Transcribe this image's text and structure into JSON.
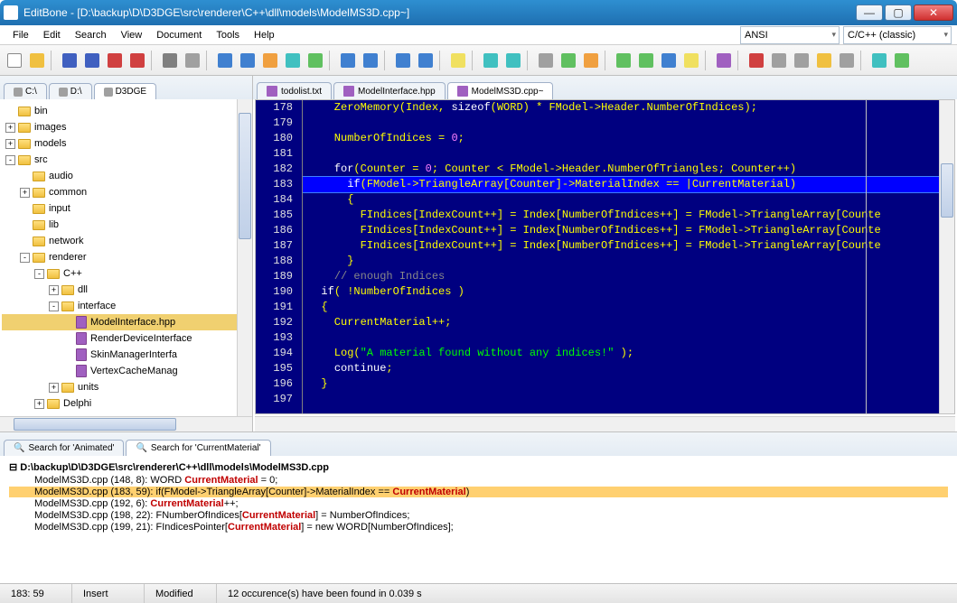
{
  "title": "EditBone - [D:\\backup\\D\\D3DGE\\src\\renderer\\C++\\dll\\models\\ModelMS3D.cpp~]",
  "menu": [
    "File",
    "Edit",
    "Search",
    "View",
    "Document",
    "Tools",
    "Help"
  ],
  "encoding": "ANSI",
  "language": "C/C++ (classic)",
  "drive_tabs": [
    {
      "label": "C:\\",
      "active": false
    },
    {
      "label": "D:\\",
      "active": false
    },
    {
      "label": "D3DGE",
      "active": true
    }
  ],
  "tree": [
    {
      "indent": 0,
      "exp": "",
      "icon": "folder",
      "label": "bin"
    },
    {
      "indent": 0,
      "exp": "+",
      "icon": "folder",
      "label": "images"
    },
    {
      "indent": 0,
      "exp": "+",
      "icon": "folder",
      "label": "models"
    },
    {
      "indent": 0,
      "exp": "-",
      "icon": "folder",
      "label": "src"
    },
    {
      "indent": 1,
      "exp": "",
      "icon": "folder",
      "label": "audio"
    },
    {
      "indent": 1,
      "exp": "+",
      "icon": "folder",
      "label": "common"
    },
    {
      "indent": 1,
      "exp": "",
      "icon": "folder",
      "label": "input"
    },
    {
      "indent": 1,
      "exp": "",
      "icon": "folder",
      "label": "lib"
    },
    {
      "indent": 1,
      "exp": "",
      "icon": "folder",
      "label": "network"
    },
    {
      "indent": 1,
      "exp": "-",
      "icon": "folder",
      "label": "renderer"
    },
    {
      "indent": 2,
      "exp": "-",
      "icon": "folder",
      "label": "C++"
    },
    {
      "indent": 3,
      "exp": "+",
      "icon": "folder",
      "label": "dll"
    },
    {
      "indent": 3,
      "exp": "-",
      "icon": "folder",
      "label": "interface"
    },
    {
      "indent": 4,
      "exp": "",
      "icon": "file",
      "label": "ModelInterface.hpp",
      "selected": true
    },
    {
      "indent": 4,
      "exp": "",
      "icon": "file",
      "label": "RenderDeviceInterface"
    },
    {
      "indent": 4,
      "exp": "",
      "icon": "file",
      "label": "SkinManagerInterfa"
    },
    {
      "indent": 4,
      "exp": "",
      "icon": "file",
      "label": "VertexCacheManag"
    },
    {
      "indent": 3,
      "exp": "+",
      "icon": "folder",
      "label": "units"
    },
    {
      "indent": 2,
      "exp": "+",
      "icon": "folder",
      "label": "Delphi"
    }
  ],
  "file_tabs": [
    {
      "label": "todolist.txt",
      "active": false
    },
    {
      "label": "ModelInterface.hpp",
      "active": false
    },
    {
      "label": "ModelMS3D.cpp~",
      "active": true
    }
  ],
  "code_lines": [
    {
      "n": 178,
      "html": "    ZeroMemory(Index, <span class='kw'>sizeof</span>(WORD) * FModel->Header.NumberOfIndices);"
    },
    {
      "n": 179,
      "html": ""
    },
    {
      "n": 180,
      "html": "    NumberOfIndices = <span class='num'>0</span>;"
    },
    {
      "n": 181,
      "html": ""
    },
    {
      "n": 182,
      "html": "    <span class='kw'>for</span>(Counter = <span class='num'>0</span>; Counter < FModel->Header.NumberOfTriangles; Counter++)"
    },
    {
      "n": 183,
      "html": "      <span class='kw'>if</span>(FModel->TriangleArray[Counter]->MaterialIndex == |CurrentMaterial)",
      "current": true
    },
    {
      "n": 184,
      "html": "      {"
    },
    {
      "n": 185,
      "html": "        FIndices[IndexCount++] = Index[NumberOfIndices++] = FModel->TriangleArray[Counte"
    },
    {
      "n": 186,
      "html": "        FIndices[IndexCount++] = Index[NumberOfIndices++] = FModel->TriangleArray[Counte"
    },
    {
      "n": 187,
      "html": "        FIndices[IndexCount++] = Index[NumberOfIndices++] = FModel->TriangleArray[Counte"
    },
    {
      "n": 188,
      "html": "      }"
    },
    {
      "n": 189,
      "html": "    <span class='cmt'>// enough Indices</span>"
    },
    {
      "n": 190,
      "html": "  <span class='kw'>if</span>( !NumberOfIndices )"
    },
    {
      "n": 191,
      "html": "  {"
    },
    {
      "n": 192,
      "html": "    CurrentMaterial++;"
    },
    {
      "n": 193,
      "html": ""
    },
    {
      "n": 194,
      "html": "    Log(<span class='str'>\"A material found without any indices!\"</span> );"
    },
    {
      "n": 195,
      "html": "    <span class='kw'>continue</span>;"
    },
    {
      "n": 196,
      "html": "  }"
    },
    {
      "n": 197,
      "html": ""
    }
  ],
  "search_tabs": [
    {
      "label": "Search for 'Animated'",
      "active": false
    },
    {
      "label": "Search for 'CurrentMaterial'",
      "active": true
    }
  ],
  "search_file": "D:\\backup\\D\\D3DGE\\src\\renderer\\C++\\dll\\models\\ModelMS3D.cpp",
  "search_results": [
    {
      "loc": "ModelMS3D.cpp (148, 8):",
      "pre": "   WORD ",
      "match": "CurrentMaterial",
      "post": " = 0;"
    },
    {
      "loc": "ModelMS3D.cpp (183, 59):",
      "pre": "      if(FModel->TriangleArray[Counter]->MaterialIndex == ",
      "match": "CurrentMaterial",
      "post": ")",
      "hl": true
    },
    {
      "loc": "ModelMS3D.cpp (192, 6):",
      "pre": "   ",
      "match": "CurrentMaterial",
      "post": "++;"
    },
    {
      "loc": "ModelMS3D.cpp (198, 22):",
      "pre": "   FNumberOfIndices[",
      "match": "CurrentMaterial",
      "post": "] = NumberOfIndices;"
    },
    {
      "loc": "ModelMS3D.cpp (199, 21):",
      "pre": "   FIndicesPointer[",
      "match": "CurrentMaterial",
      "post": "] = new WORD[NumberOfIndices];"
    }
  ],
  "status": {
    "pos": "183: 59",
    "insert": "Insert",
    "modified": "Modified",
    "msg": "12 occurence(s) have been found in 0.039 s"
  }
}
